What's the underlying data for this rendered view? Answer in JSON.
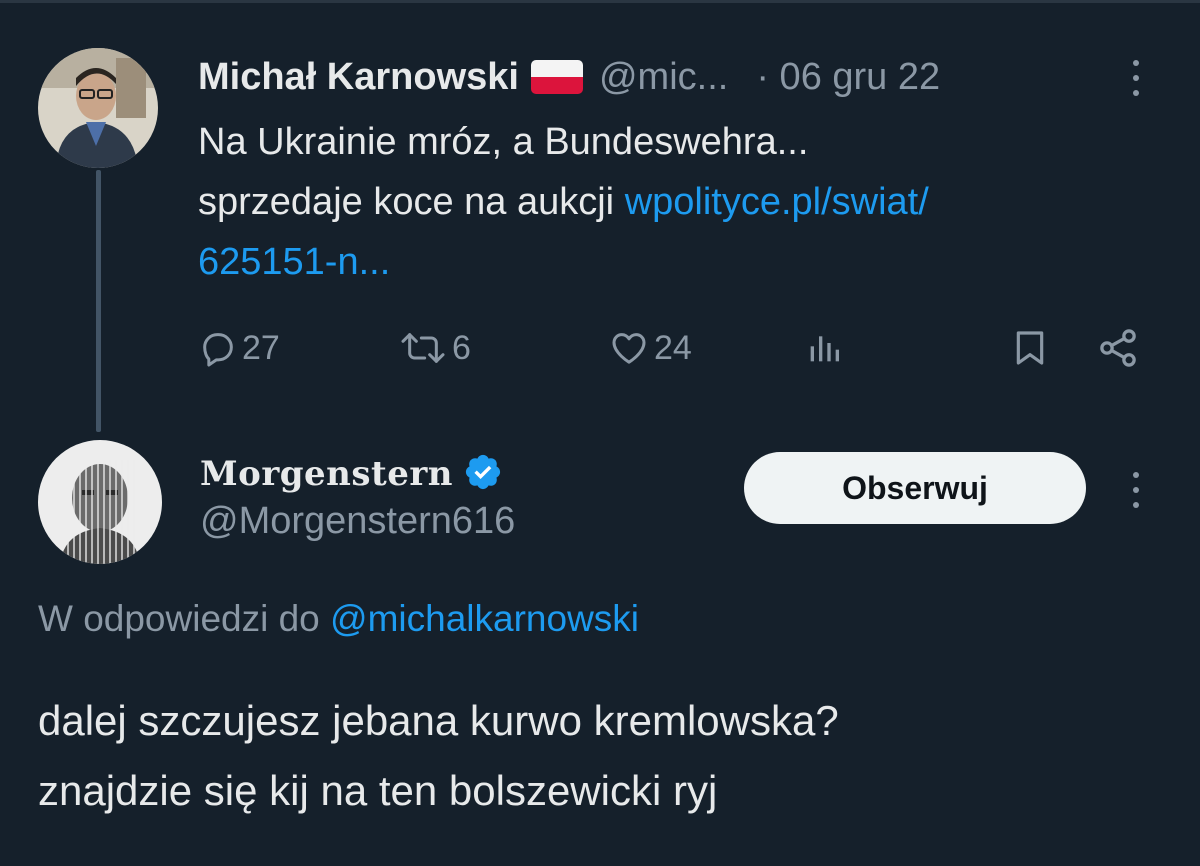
{
  "tweet1": {
    "author_name": "Michał Karnowski",
    "flag_icon": "poland-flag-icon",
    "handle": "@mic...",
    "date": "· 06 gru 22",
    "text_line1": "Na Ukrainie mróz, a Bundeswehra...",
    "text_line2_plain": "sprzedaje koce na aukcji ",
    "text_line2_link": "wpolityce.pl/swiat/",
    "text_line3_link": "625151-n...",
    "replies": "27",
    "retweets": "6",
    "likes": "24"
  },
  "tweet2": {
    "author_name": "Morgenstern",
    "handle": "@Morgenstern616",
    "follow_label": "Obserwuj",
    "reply_prefix": "W odpowiedzi do ",
    "reply_handle": "@michalkarnowski",
    "text_line1": "dalej szczujesz jebana kurwo kremlowska?",
    "text_line2": "znajdzie się kij na ten bolszewicki ryj"
  },
  "colors": {
    "background": "#15202b",
    "text": "#e7e9ea",
    "secondary": "#8b98a5",
    "link": "#1d9bf0",
    "verified": "#1d9bf0",
    "thread_line": "#425466"
  }
}
